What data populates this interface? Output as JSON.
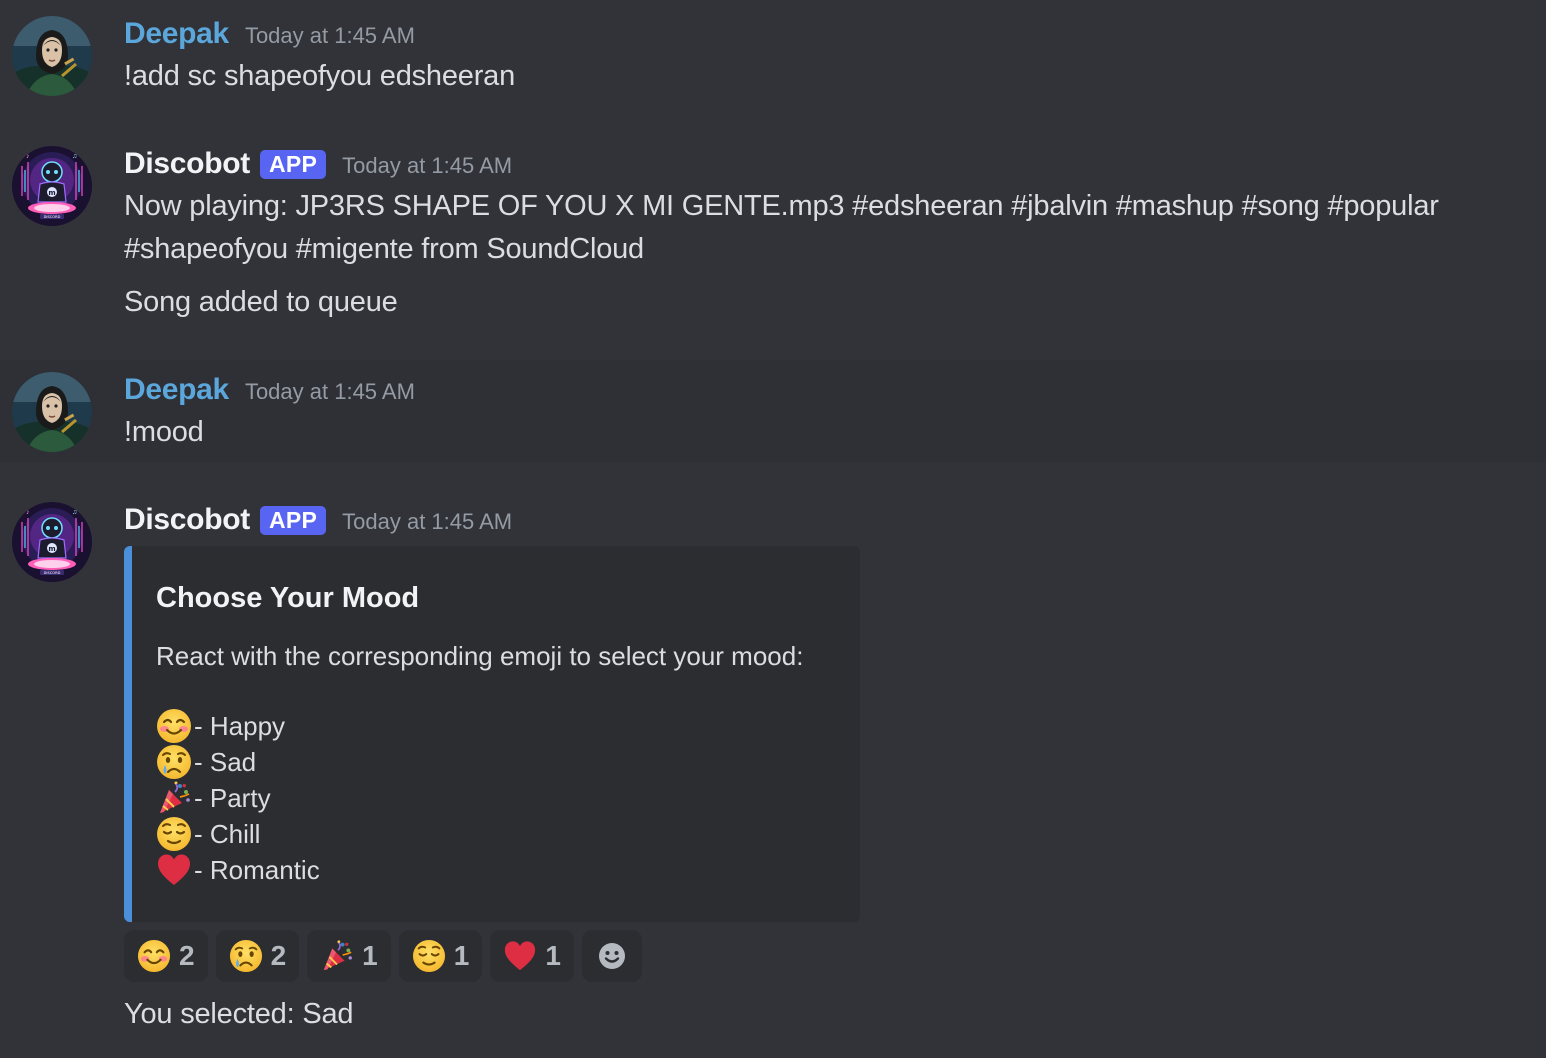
{
  "messages": [
    {
      "author": "Deepak",
      "timestamp": "Today at 1:45 AM",
      "content": "!add sc shapeofyou edsheeran"
    },
    {
      "author": "Discobot",
      "badge": "APP",
      "timestamp": "Today at 1:45 AM",
      "content_line1": "Now playing: JP3RS SHAPE OF YOU X MI GENTE.mp3  #edsheeran #jbalvin #mashup #song #popular",
      "content_line2": "#shapeofyou #migente from SoundCloud",
      "content_line3": "Song added to queue"
    },
    {
      "author": "Deepak",
      "timestamp": "Today at 1:45 AM",
      "content": "!mood"
    },
    {
      "author": "Discobot",
      "badge": "APP",
      "timestamp": "Today at 1:45 AM",
      "embed": {
        "title": "Choose Your Mood",
        "description": "React with the corresponding emoji to select your mood:",
        "accent_color": "#4a8fd8",
        "moods": [
          {
            "icon": "smiling-face-with-smiling-eyes-icon",
            "label": "- Happy"
          },
          {
            "icon": "crying-face-icon",
            "label": "- Sad"
          },
          {
            "icon": "party-popper-icon",
            "label": "- Party"
          },
          {
            "icon": "relieved-face-icon",
            "label": "- Chill"
          },
          {
            "icon": "red-heart-icon",
            "label": "- Romantic"
          }
        ]
      },
      "reactions": [
        {
          "icon": "smiling-face-with-smiling-eyes-icon",
          "count": "2"
        },
        {
          "icon": "crying-face-icon",
          "count": "2"
        },
        {
          "icon": "party-popper-icon",
          "count": "1"
        },
        {
          "icon": "relieved-face-icon",
          "count": "1"
        },
        {
          "icon": "red-heart-icon",
          "count": "1"
        }
      ],
      "add_reaction_icon": "add-reaction-icon",
      "followup": "You selected: Sad"
    }
  ],
  "colors": {
    "background": "#313338",
    "user_name": "#5ba7dc",
    "app_badge": "#5865f2"
  }
}
